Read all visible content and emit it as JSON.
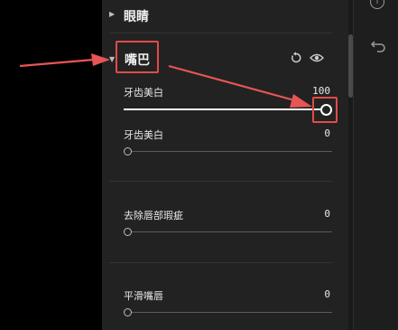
{
  "sections": {
    "eyes": {
      "title": "眼睛"
    },
    "mouth": {
      "title": "嘴巴"
    }
  },
  "sliders": [
    {
      "label": "牙齿美白",
      "value": "100",
      "level": 1.0
    },
    {
      "label": "牙齿美白",
      "value": "0",
      "level": 0.0
    },
    {
      "label": "去除唇部瑕疵",
      "value": "0",
      "level": 0.0
    },
    {
      "label": "平滑嘴唇",
      "value": "0",
      "level": 0.0
    }
  ],
  "icons": {
    "reset": "reset-icon",
    "visibility": "eye-icon",
    "info": "info-icon",
    "undo": "undo-icon"
  },
  "info_glyph": "i",
  "colors": {
    "highlight": "#e24a4a",
    "panel": "#222222",
    "track": "#5b5b5b",
    "active_fill": "#ffffff"
  }
}
